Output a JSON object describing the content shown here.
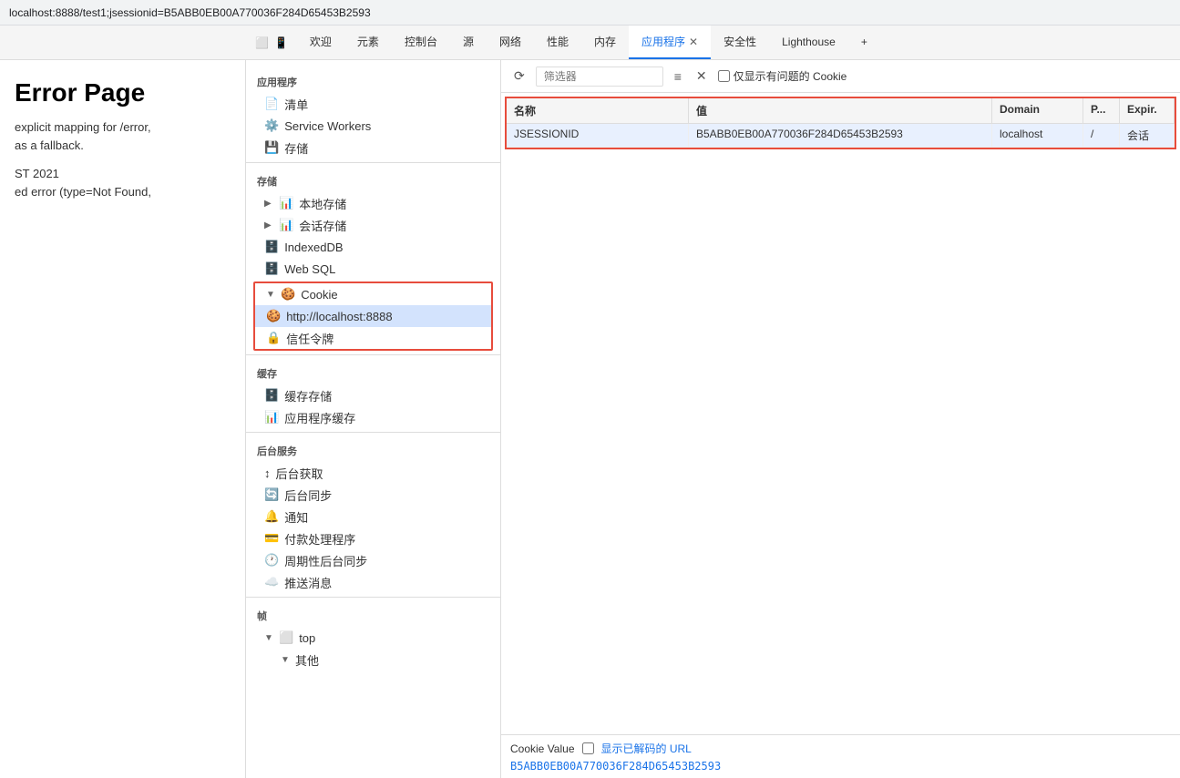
{
  "addressBar": {
    "url": "localhost:8888/test1;jsessionid=B5ABB0EB00A770036F284D65453B2593"
  },
  "devtoolsTabs": {
    "items": [
      {
        "label": "欢迎",
        "active": false
      },
      {
        "label": "元素",
        "active": false
      },
      {
        "label": "控制台",
        "active": false
      },
      {
        "label": "源",
        "active": false
      },
      {
        "label": "网络",
        "active": false
      },
      {
        "label": "性能",
        "active": false
      },
      {
        "label": "内存",
        "active": false
      },
      {
        "label": "应用程序",
        "active": true,
        "closeable": true
      },
      {
        "label": "安全性",
        "active": false
      },
      {
        "label": "Lighthouse",
        "active": false
      }
    ],
    "icons": {
      "select": "⬜",
      "device": "📱",
      "plus": "+"
    }
  },
  "pageContent": {
    "title": "Error Page",
    "lines": [
      "explicit mapping for /error,",
      "as a fallback.",
      "",
      "ST 2021",
      "ed error (type=Not Found,"
    ]
  },
  "sidebar": {
    "appSection": "应用程序",
    "appItems": [
      {
        "label": "清单",
        "icon": "📄"
      },
      {
        "label": "Service Workers",
        "icon": "⚙️"
      },
      {
        "label": "存储",
        "icon": "💾"
      }
    ],
    "storageSection": "存储",
    "storageItems": [
      {
        "label": "本地存储",
        "icon": "📊",
        "arrow": "▶",
        "indented": false
      },
      {
        "label": "会话存储",
        "icon": "📊",
        "arrow": "▶",
        "indented": false
      },
      {
        "label": "IndexedDB",
        "icon": "🗄️",
        "indented": false
      },
      {
        "label": "Web SQL",
        "icon": "🗄️",
        "indented": false
      }
    ],
    "cookieGroup": {
      "parent": {
        "label": "Cookie",
        "icon": "🍪",
        "arrow": "▼"
      },
      "child": {
        "label": "http://localhost:8888",
        "icon": "🍪",
        "selected": true
      }
    },
    "trustItem": {
      "label": "信任令牌",
      "icon": "🔒"
    },
    "cacheSection": "缓存",
    "cacheItems": [
      {
        "label": "缓存存储",
        "icon": "🗄️"
      },
      {
        "label": "应用程序缓存",
        "icon": "📊"
      }
    ],
    "backgroundSection": "后台服务",
    "backgroundItems": [
      {
        "label": "后台获取",
        "icon": "↕"
      },
      {
        "label": "后台同步",
        "icon": "🔄"
      },
      {
        "label": "通知",
        "icon": "🔔"
      },
      {
        "label": "付款处理程序",
        "icon": "💳"
      },
      {
        "label": "周期性后台同步",
        "icon": "🕐"
      },
      {
        "label": "推送消息",
        "icon": "☁️"
      }
    ],
    "framesSection": "帧",
    "framesItems": [
      {
        "label": "top",
        "icon": "⬜",
        "arrow": "▼",
        "indent": 0
      },
      {
        "label": "其他",
        "icon": "",
        "arrow": "▼",
        "indent": 1
      }
    ]
  },
  "toolbar": {
    "refreshLabel": "⟳",
    "filterPlaceholder": "筛选器",
    "filterIcon": "≡",
    "closeIcon": "✕",
    "showProblematicLabel": "仅显示有问题的 Cookie"
  },
  "cookieTable": {
    "headers": [
      "名称",
      "值",
      "Domain",
      "P...",
      "Expir."
    ],
    "rows": [
      {
        "name": "JSESSIONID",
        "value": "B5ABB0EB00A770036F284D65453B2593",
        "domain": "localhost",
        "path": "/",
        "expiry": "会话"
      }
    ]
  },
  "cookieValue": {
    "label": "Cookie Value",
    "showDecodedLabel": "显示已解码的 URL",
    "value": "B5ABB0EB00A770036F284D65453B2593"
  }
}
